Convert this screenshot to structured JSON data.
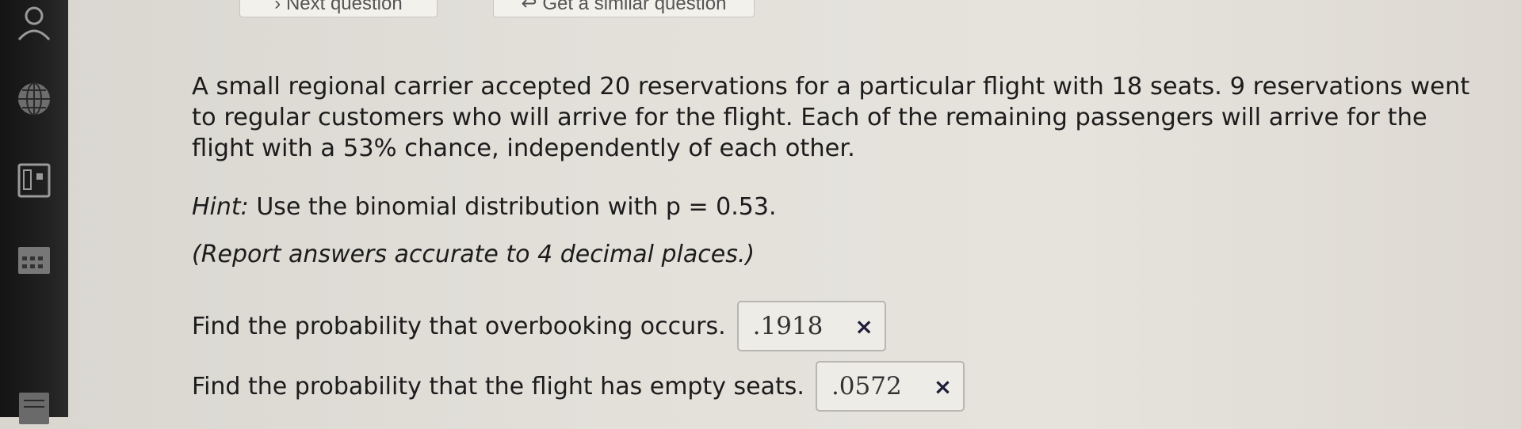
{
  "topbar": {
    "next_label": "› Next question",
    "similar_label": "↩ Get a similar question"
  },
  "sidebar": {
    "icons": [
      "user-icon",
      "globe-icon",
      "calculator-icon",
      "calendar-icon",
      "document-icon"
    ]
  },
  "question": {
    "text": "A small regional carrier accepted 20 reservations for a particular flight with 18 seats. 9 reservations went to regular customers who will arrive for the flight. Each of the remaining passengers will arrive for the flight with a 53% chance, independently of each other.",
    "hint_label": "Hint:",
    "hint_text": " Use the binomial distribution with p = 0.53.",
    "report_note": "(Report answers accurate to 4 decimal places.)"
  },
  "parts": [
    {
      "prompt": "Find the probability that overbooking occurs.",
      "answer": ".1918",
      "status": "×"
    },
    {
      "prompt": "Find the probability that the flight has empty seats.",
      "answer": ".0572",
      "status": "×"
    }
  ],
  "colors": {
    "background": "#e3e0da",
    "sidebar": "#1c1c1c",
    "text": "#1c1c1c",
    "incorrect_mark": "#1d1d3a"
  }
}
